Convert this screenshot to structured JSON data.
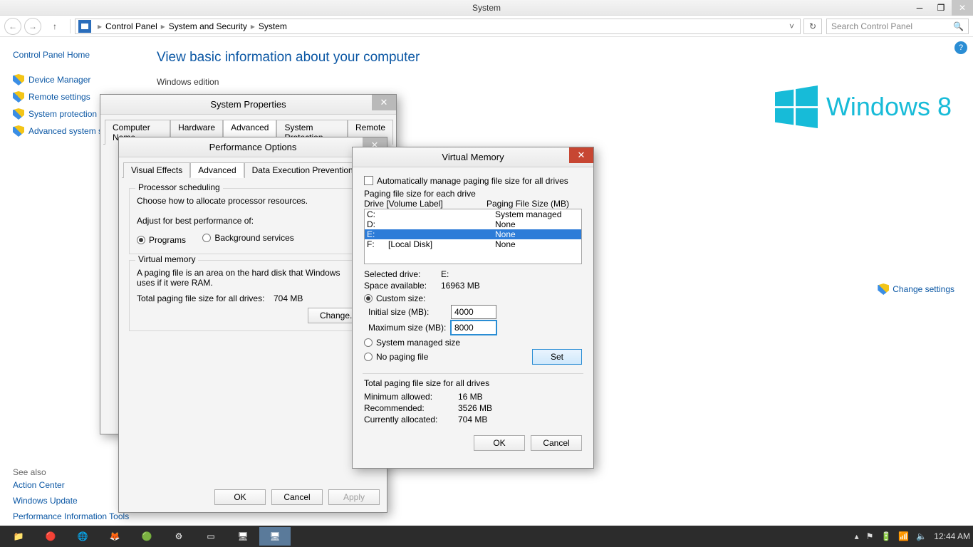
{
  "window": {
    "title": "System"
  },
  "breadcrumb": {
    "items": [
      "Control Panel",
      "System and Security",
      "System"
    ]
  },
  "search": {
    "placeholder": "Search Control Panel"
  },
  "sidebar": {
    "home": "Control Panel Home",
    "links": [
      "Device Manager",
      "Remote settings",
      "System protection",
      "Advanced system s"
    ],
    "seealso_title": "See also",
    "seealso": [
      "Action Center",
      "Windows Update",
      "Performance Information Tools"
    ]
  },
  "main": {
    "heading": "View basic information about your computer",
    "section0": "Windows edition",
    "brand": "Windows 8",
    "change_settings": "Change settings"
  },
  "sysprops": {
    "title": "System Properties",
    "tabs": [
      "Computer Name",
      "Hardware",
      "Advanced",
      "System Protection",
      "Remote"
    ],
    "active_tab": 2
  },
  "perf": {
    "title": "Performance Options",
    "tabs": [
      "Visual Effects",
      "Advanced",
      "Data Execution Prevention"
    ],
    "active_tab": 1,
    "proc_scheduling": "Processor scheduling",
    "proc_desc": "Choose how to allocate processor resources.",
    "adjust_for": "Adjust for best performance of:",
    "programs": "Programs",
    "bg": "Background services",
    "vm_legend": "Virtual memory",
    "vm_desc": "A paging file is an area on the hard disk that Windows uses if it were RAM.",
    "vm_total_label": "Total paging file size for all drives:",
    "vm_total_val": "704 MB",
    "change": "Change...",
    "ok": "OK",
    "cancel": "Cancel",
    "apply": "Apply"
  },
  "vm": {
    "title": "Virtual Memory",
    "auto": "Automatically manage paging file size for all drives",
    "pfs_label": "Paging file size for each drive",
    "col_drive": "Drive  [Volume Label]",
    "col_pfs": "Paging File Size (MB)",
    "drives": [
      {
        "d": "C:",
        "l": "",
        "p": "System managed",
        "sel": false
      },
      {
        "d": "D:",
        "l": "",
        "p": "None",
        "sel": false
      },
      {
        "d": "E:",
        "l": "",
        "p": "None",
        "sel": true
      },
      {
        "d": "F:",
        "l": "[Local Disk]",
        "p": "None",
        "sel": false
      }
    ],
    "sel_drive_l": "Selected drive:",
    "sel_drive_v": "E:",
    "space_l": "Space available:",
    "space_v": "16963 MB",
    "custom": "Custom size:",
    "init_l": "Initial size (MB):",
    "init_v": "4000",
    "max_l": "Maximum size (MB):",
    "max_v": "8000",
    "sysmgd": "System managed size",
    "nopf": "No paging file",
    "set": "Set",
    "total_label": "Total paging file size for all drives",
    "min_l": "Minimum allowed:",
    "min_v": "16 MB",
    "rec_l": "Recommended:",
    "rec_v": "3526 MB",
    "cur_l": "Currently allocated:",
    "cur_v": "704 MB",
    "ok": "OK",
    "cancel": "Cancel"
  },
  "taskbar": {
    "time": "12:44 AM"
  }
}
